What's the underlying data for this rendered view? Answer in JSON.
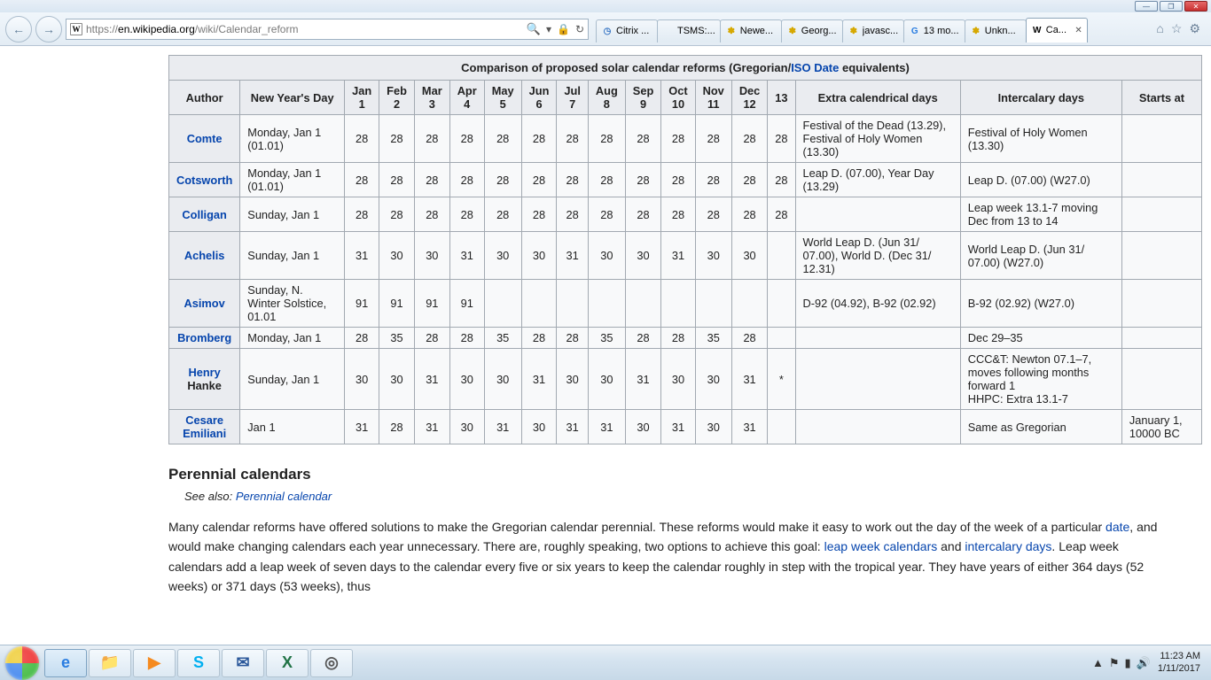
{
  "window": {
    "minimize": "—",
    "maximize": "❐",
    "close": "✕"
  },
  "ie": {
    "back": "←",
    "forward": "→",
    "url_proto": "https://",
    "url_host": "en.wikipedia.org",
    "url_path": "/wiki/Calendar_reform",
    "favicon": "W",
    "search": "🔍",
    "dropdown": "▾",
    "refresh": "↻",
    "lock": "🔒",
    "home": "⌂",
    "star": "☆",
    "gear": "⚙",
    "tabs": [
      {
        "icon": "◷",
        "iconcolor": "#3a77c5",
        "label": "Citrix ..."
      },
      {
        "icon": "",
        "iconcolor": "",
        "label": "TSMS:..."
      },
      {
        "icon": "✽",
        "iconcolor": "#d6a800",
        "label": "Newe..."
      },
      {
        "icon": "✽",
        "iconcolor": "#d6a800",
        "label": "Georg..."
      },
      {
        "icon": "✽",
        "iconcolor": "#d6a800",
        "label": "javasc..."
      },
      {
        "icon": "G",
        "iconcolor": "#2a7de1",
        "label": "13 mo..."
      },
      {
        "icon": "✽",
        "iconcolor": "#d6a800",
        "label": "Unkn..."
      },
      {
        "icon": "W",
        "iconcolor": "#000",
        "label": "Ca...",
        "active": true
      }
    ]
  },
  "caption": {
    "pre": "Comparison of proposed solar calendar reforms (Gregorian/",
    "link": "ISO Date",
    "post": " equivalents)"
  },
  "headers": {
    "author": "Author",
    "nyd": "New Year's Day",
    "months": [
      "Jan 1",
      "Feb 2",
      "Mar 3",
      "Apr 4",
      "May 5",
      "Jun 6",
      "Jul 7",
      "Aug 8",
      "Sep 9",
      "Oct 10",
      "Nov 11",
      "Dec 12",
      "13"
    ],
    "extra": "Extra calendrical days",
    "inter": "Intercalary days",
    "starts": "Starts at"
  },
  "rows": [
    {
      "author": "Comte",
      "author2": "",
      "nyd": "Monday, Jan 1 (01.01)",
      "m": [
        "28",
        "28",
        "28",
        "28",
        "28",
        "28",
        "28",
        "28",
        "28",
        "28",
        "28",
        "28",
        "28"
      ],
      "extra": "Festival of the Dead (13.29), Festival of Holy Women (13.30)",
      "inter": "Festival of Holy Women (13.30)",
      "starts": ""
    },
    {
      "author": "Cotsworth",
      "author2": "",
      "nyd": "Monday, Jan 1 (01.01)",
      "m": [
        "28",
        "28",
        "28",
        "28",
        "28",
        "28",
        "28",
        "28",
        "28",
        "28",
        "28",
        "28",
        "28"
      ],
      "extra": "Leap D. (07.00), Year Day (13.29)",
      "inter": "Leap D. (07.00) (W27.0)",
      "starts": ""
    },
    {
      "author": "Colligan",
      "author2": "",
      "nyd": "Sunday, Jan 1",
      "m": [
        "28",
        "28",
        "28",
        "28",
        "28",
        "28",
        "28",
        "28",
        "28",
        "28",
        "28",
        "28",
        "28"
      ],
      "extra": "",
      "inter": "Leap week 13.1-7 moving Dec from 13 to 14",
      "starts": ""
    },
    {
      "author": "Achelis",
      "author2": "",
      "nyd": "Sunday, Jan 1",
      "m": [
        "31",
        "30",
        "30",
        "31",
        "30",
        "30",
        "31",
        "30",
        "30",
        "31",
        "30",
        "30",
        ""
      ],
      "extra": "World Leap D. (Jun 31/ 07.00), World D. (Dec 31/ 12.31)",
      "inter": "World Leap D. (Jun 31/ 07.00) (W27.0)",
      "starts": ""
    },
    {
      "author": "Asimov",
      "author2": "",
      "nyd": "Sunday, N. Winter Solstice, 01.01",
      "m": [
        "91",
        "91",
        "91",
        "91",
        "",
        "",
        "",
        "",
        "",
        "",
        "",
        "",
        ""
      ],
      "extra": "D-92 (04.92), B-92 (02.92)",
      "inter": "B-92 (02.92) (W27.0)",
      "starts": ""
    },
    {
      "author": "Bromberg",
      "author2": "",
      "nyd": "Monday, Jan 1",
      "m": [
        "28",
        "35",
        "28",
        "28",
        "35",
        "28",
        "28",
        "35",
        "28",
        "28",
        "35",
        "28",
        ""
      ],
      "extra": "",
      "inter": "Dec 29–35",
      "starts": ""
    },
    {
      "author": "Henry",
      "author2": "Hanke",
      "nyd": "Sunday, Jan 1",
      "m": [
        "30",
        "30",
        "31",
        "30",
        "30",
        "31",
        "30",
        "30",
        "31",
        "30",
        "30",
        "31",
        "*"
      ],
      "extra": "",
      "inter": "CCC&T: Newton 07.1–7, moves following months forward 1\nHHPC: Extra 13.1-7",
      "starts": ""
    },
    {
      "author": "Cesare",
      "author2": "Emiliani",
      "nyd": "Jan 1",
      "m": [
        "31",
        "28",
        "31",
        "30",
        "31",
        "30",
        "31",
        "31",
        "30",
        "31",
        "30",
        "31",
        ""
      ],
      "extra": "",
      "inter": "Same as Gregorian",
      "starts": "January 1, 10000 BC"
    }
  ],
  "prose": {
    "h3": "Perennial calendars",
    "seealso_pre": "See also: ",
    "seealso_link": "Perennial calendar",
    "p1a": "Many calendar reforms have offered solutions to make the Gregorian calendar perennial. These reforms would make it easy to work out the day of the week of a particular ",
    "p1link1": "date",
    "p1b": ", and would make changing calendars each year unnecessary. There are, roughly speaking, two options to achieve this goal: ",
    "p1link2": "leap week calendars",
    "p1c": " and ",
    "p1link3": "intercalary days",
    "p1d": ". Leap week calendars add a leap week of seven days to the calendar every five or six years to keep the calendar roughly in step with the tropical year. They have years of either 364 days (52 weeks) or 371 days (53 weeks), thus"
  },
  "taskbar": {
    "icons": [
      {
        "glyph": "e",
        "color": "#2a7de1",
        "name": "ie"
      },
      {
        "glyph": "📁",
        "color": "",
        "name": "explorer"
      },
      {
        "glyph": "▶",
        "color": "#f58a1f",
        "name": "wmp"
      },
      {
        "glyph": "S",
        "color": "#00aff0",
        "name": "skype"
      },
      {
        "glyph": "✉",
        "color": "#2a579a",
        "name": "outlook"
      },
      {
        "glyph": "X",
        "color": "#217346",
        "name": "excel"
      },
      {
        "glyph": "◎",
        "color": "#555",
        "name": "app"
      }
    ],
    "tray": {
      "up": "▲",
      "flag": "⚑",
      "net": "▮",
      "vol": "🔊",
      "time": "11:23 AM",
      "date": "1/11/2017"
    }
  }
}
